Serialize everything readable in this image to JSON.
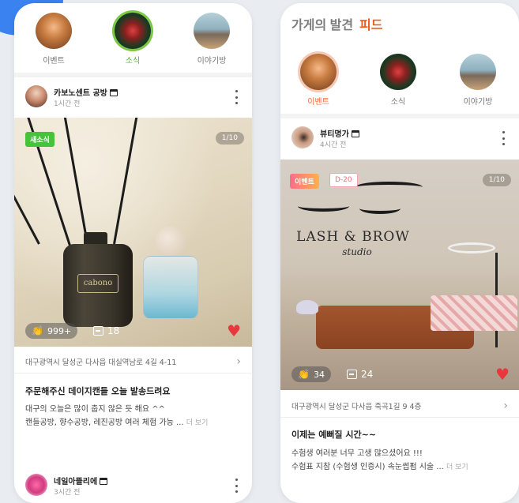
{
  "left_phone": {
    "stories": [
      {
        "label": "이벤트",
        "icon": "event-avatar"
      },
      {
        "label": "소식",
        "icon": "news-avatar",
        "active": true
      },
      {
        "label": "이야기방",
        "icon": "story-room-avatar"
      }
    ],
    "post": {
      "author": "카보노센트 공방",
      "time": "1시간 전",
      "badge": "새소식",
      "counter": "1/10",
      "claps": "999+",
      "comments": "18",
      "address": "대구광역시 달성군 다사읍 대실역남로 4길 4-11",
      "title": "주문해주신 데이지캔들 오늘 발송드려요",
      "body_line1": "대구의 오늘은 많이 춥지 않은 듯 해요 ^^",
      "body_line2": "캔들공방, 향수공방, 레진공방 여러 체험 가능 ...",
      "more": "더 보기",
      "bottle_label": "cabono"
    },
    "next_post": {
      "author": "네일아뜰리에",
      "time": "3시간 전"
    }
  },
  "right_phone": {
    "title": "가게의 발견",
    "title_accent": "피드",
    "stories": [
      {
        "label": "이벤트",
        "icon": "event-avatar",
        "active": true
      },
      {
        "label": "소식",
        "icon": "news-avatar"
      },
      {
        "label": "이야기방",
        "icon": "story-room-avatar"
      }
    ],
    "post": {
      "author": "뷰티명가",
      "time": "4시간 전",
      "badge": "이벤트",
      "dday": "D-20",
      "counter": "1/10",
      "sign_line1": "LASH & BROW",
      "sign_line2": "studio",
      "claps": "34",
      "comments": "24",
      "address": "대구광역시 달성군 다사읍 죽곡1길 9 4층",
      "title": "이제는 예뻐질 시간~~",
      "body_line1": "수험생 여러분 너무 고생 많으셨어요 !!!",
      "body_line2": "수험표 지참 (수험생 인증시) 속눈썹펌 시술 ...",
      "more": "더 보기"
    }
  },
  "colors": {
    "accent_green": "#59b136",
    "accent_orange": "#f15a22",
    "heart_red": "#e8383d",
    "corner_blue": "#3a82f0"
  }
}
